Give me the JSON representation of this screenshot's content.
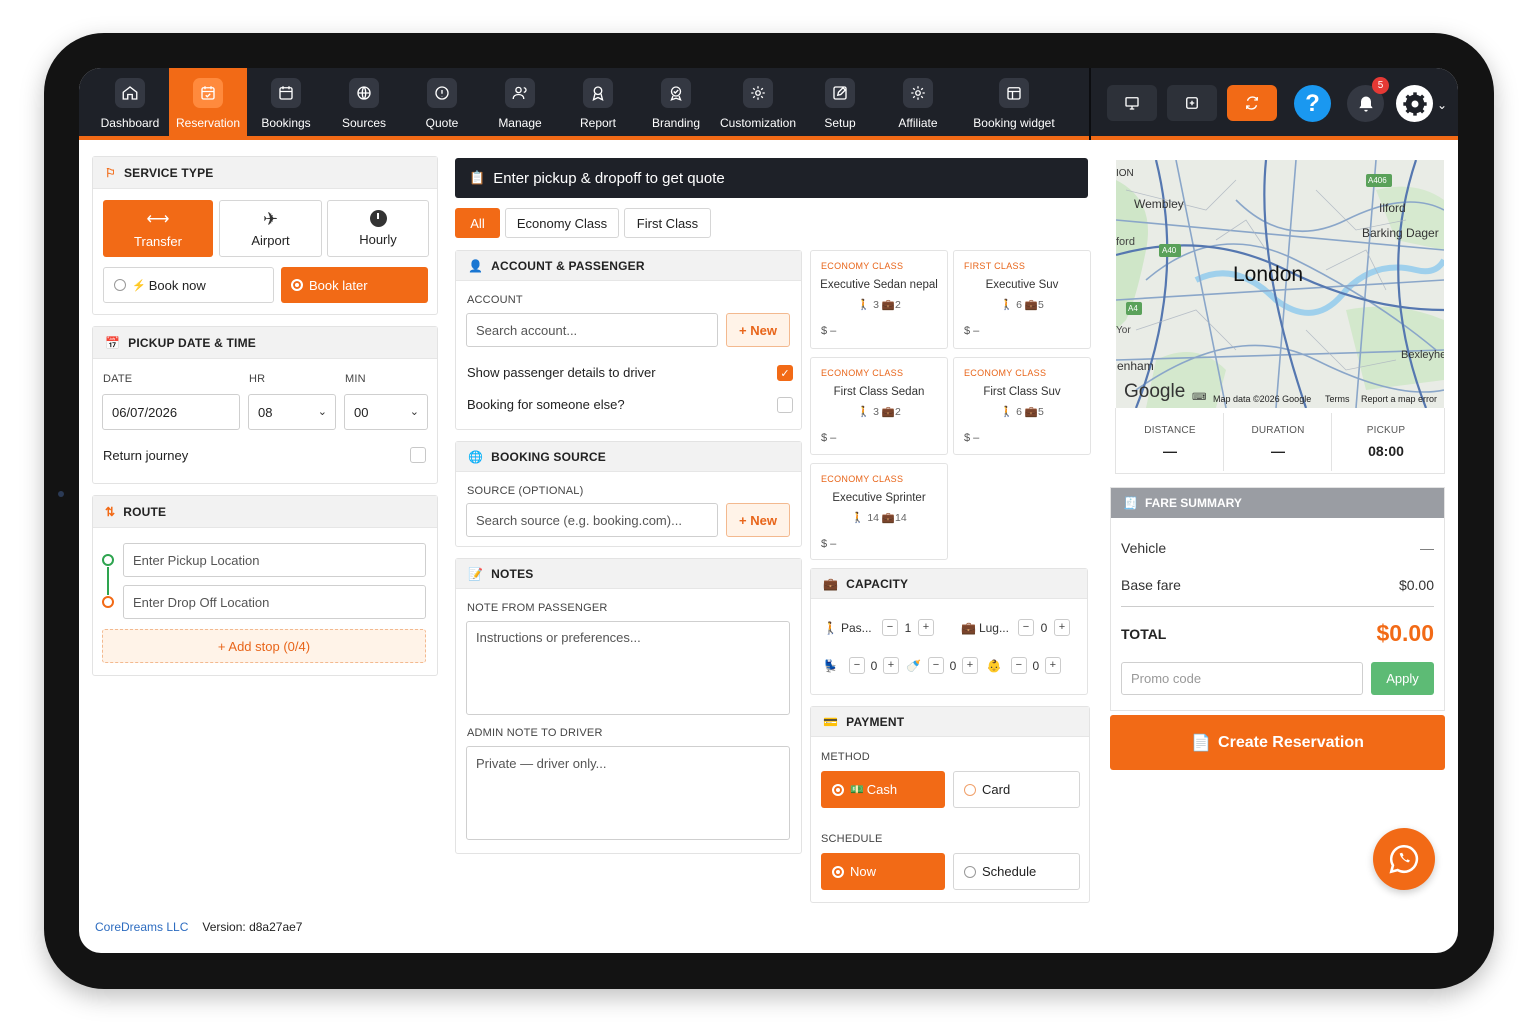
{
  "nav": [
    {
      "label": "Dashboard",
      "icon": "home-icon"
    },
    {
      "label": "Reservation",
      "icon": "calendar-check-icon",
      "active": true
    },
    {
      "label": "Bookings",
      "icon": "calendar-icon"
    },
    {
      "label": "Sources",
      "icon": "globe-icon"
    },
    {
      "label": "Quote",
      "icon": "quote-icon"
    },
    {
      "label": "Manage",
      "icon": "users-icon"
    },
    {
      "label": "Report",
      "icon": "award-icon"
    },
    {
      "label": "Branding",
      "icon": "brand-icon"
    },
    {
      "label": "Customization",
      "icon": "gear-icon"
    },
    {
      "label": "Setup",
      "icon": "edit-icon"
    },
    {
      "label": "Affiliate",
      "icon": "gear-icon"
    },
    {
      "label": "Booking widget",
      "icon": "widget-icon"
    }
  ],
  "topbar": {
    "notifications": "5",
    "help": "?"
  },
  "service": {
    "title": "SERVICE TYPE",
    "types": [
      {
        "label": "Transfer",
        "active": true
      },
      {
        "label": "Airport"
      },
      {
        "label": "Hourly"
      }
    ],
    "book_now": "Book now",
    "book_later": "Book later"
  },
  "pickup": {
    "title": "PICKUP DATE & TIME",
    "date_label": "DATE",
    "hr_label": "HR",
    "min_label": "MIN",
    "date": "06/07/2026",
    "hr": "08",
    "min": "00",
    "return_label": "Return journey"
  },
  "route": {
    "title": "ROUTE",
    "pickup_placeholder": "Enter Pickup Location",
    "dropoff_placeholder": "Enter Drop Off Location",
    "add_stop": "+ Add stop (0/4)"
  },
  "quote": {
    "banner": "Enter pickup & dropoff to get quote",
    "filters": [
      "All",
      "Economy Class",
      "First Class"
    ]
  },
  "account": {
    "title": "ACCOUNT & PASSENGER",
    "account_label": "ACCOUNT",
    "search_placeholder": "Search account...",
    "new": "+ New",
    "show_details": "Show passenger details to driver",
    "someone_else": "Booking for someone else?"
  },
  "source": {
    "title": "BOOKING SOURCE",
    "label": "SOURCE (OPTIONAL)",
    "placeholder": "Search source (e.g. booking.com)...",
    "new": "+ New"
  },
  "notes": {
    "title": "NOTES",
    "passenger_label": "NOTE FROM PASSENGER",
    "passenger_placeholder": "Instructions or preferences...",
    "admin_label": "ADMIN NOTE TO DRIVER",
    "admin_placeholder": "Private — driver only..."
  },
  "vehicles": [
    {
      "cls": "ECONOMY CLASS",
      "name": "Executive Sedan nepal",
      "pax": "3",
      "lug": "2",
      "price": "$ –"
    },
    {
      "cls": "FIRST CLASS",
      "name": "Executive Suv",
      "pax": "6",
      "lug": "5",
      "price": "$ –"
    },
    {
      "cls": "ECONOMY CLASS",
      "name": "First Class Sedan",
      "pax": "3",
      "lug": "2",
      "price": "$ –"
    },
    {
      "cls": "ECONOMY CLASS",
      "name": "First Class Suv",
      "pax": "6",
      "lug": "5",
      "price": "$ –"
    },
    {
      "cls": "ECONOMY CLASS",
      "name": "Executive Sprinter",
      "pax": "14",
      "lug": "14",
      "price": "$ –"
    }
  ],
  "capacity": {
    "title": "CAPACITY",
    "pax_label": "Pas...",
    "pax": "1",
    "lug_label": "Lug...",
    "lug": "0",
    "seat1": "0",
    "seat2": "0",
    "seat3": "0",
    "minus": "−",
    "plus": "+"
  },
  "payment": {
    "title": "PAYMENT",
    "method_label": "METHOD",
    "cash": "Cash",
    "card": "Card",
    "schedule_label": "SCHEDULE",
    "now": "Now",
    "schedule": "Schedule"
  },
  "map": {
    "city": "London",
    "places": [
      "Wembley",
      "Ilford",
      "Barking Dager",
      "Bexleyhe",
      "enham",
      "ford",
      "ION",
      "Yor"
    ],
    "roads": [
      "A406",
      "A40",
      "A4"
    ],
    "brand": "Google",
    "attribution": "Map data ©2026 Google",
    "terms": "Terms",
    "report": "Report a map error"
  },
  "stats": [
    {
      "label": "DISTANCE",
      "value": "—"
    },
    {
      "label": "DURATION",
      "value": "—"
    },
    {
      "label": "PICKUP",
      "value": "08:00"
    }
  ],
  "fare": {
    "title": "FARE SUMMARY",
    "vehicle_label": "Vehicle",
    "vehicle_value": "—",
    "base_label": "Base fare",
    "base_value": "$0.00",
    "total_label": "TOTAL",
    "total_value": "$0.00",
    "promo_placeholder": "Promo code",
    "apply": "Apply"
  },
  "create": "Create Reservation",
  "footer": {
    "company": "CoreDreams LLC",
    "version": "Version: d8a27ae7"
  },
  "colors": {
    "accent": "#f26a16",
    "dark": "#1e2128",
    "help": "#1a98f0",
    "apply": "#5dbb75",
    "whatsapp": "#f26a16"
  }
}
